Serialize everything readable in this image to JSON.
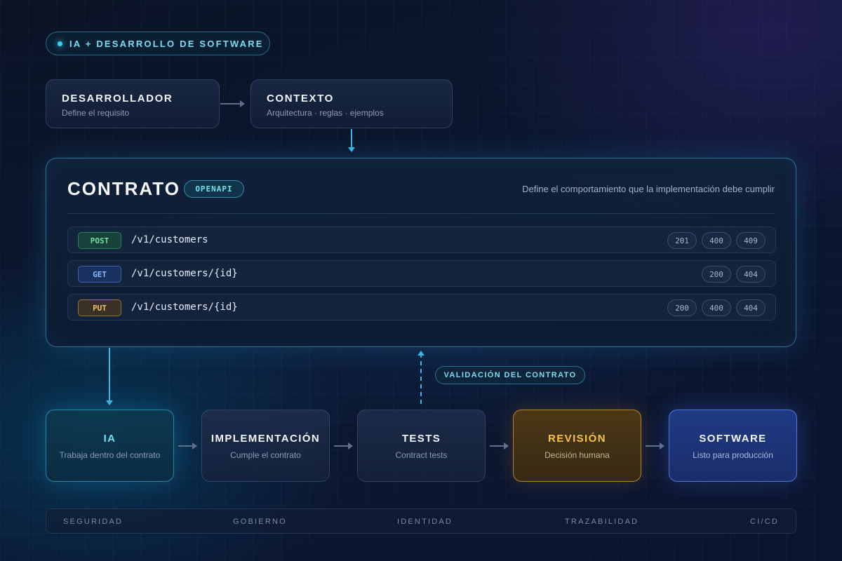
{
  "tag": {
    "label": "IA + DESARROLLO DE SOFTWARE"
  },
  "top_boxes": [
    {
      "title": "DESARROLLADOR",
      "subtitle": "Define el requisito"
    },
    {
      "title": "CONTEXTO",
      "subtitle": "Arquitectura · reglas · ejemplos"
    }
  ],
  "contract": {
    "title": "CONTRATO",
    "badge": "OPENAPI",
    "description": "Define el comportamiento que la implementación debe cumplir",
    "endpoints": [
      {
        "method": "POST",
        "path": "/v1/customers",
        "codes": [
          "201",
          "400",
          "409"
        ]
      },
      {
        "method": "GET",
        "path": "/v1/customers/{id}",
        "codes": [
          "200",
          "404"
        ]
      },
      {
        "method": "PUT",
        "path": "/v1/customers/{id}",
        "codes": [
          "200",
          "400",
          "404"
        ]
      }
    ]
  },
  "validation_label": "VALIDACIÓN DEL CONTRATO",
  "flow": [
    {
      "title": "IA",
      "subtitle": "Trabaja dentro del contrato"
    },
    {
      "title": "IMPLEMENTACIÓN",
      "subtitle": "Cumple el contrato"
    },
    {
      "title": "TESTS",
      "subtitle": "Contract tests"
    },
    {
      "title": "REVISIÓN",
      "subtitle": "Decisión humana"
    },
    {
      "title": "SOFTWARE",
      "subtitle": "Listo para producción"
    }
  ],
  "footer": [
    "SEGURIDAD",
    "GOBIERNO",
    "IDENTIDAD",
    "TRAZABILIDAD",
    "CI/CD"
  ],
  "colors": {
    "accent_cyan": "#3bb7e6",
    "post": "#6fe0a0",
    "get": "#8cb8ff",
    "put": "#f2c06a",
    "review": "#f5c250",
    "software": "#2c4fa8"
  }
}
